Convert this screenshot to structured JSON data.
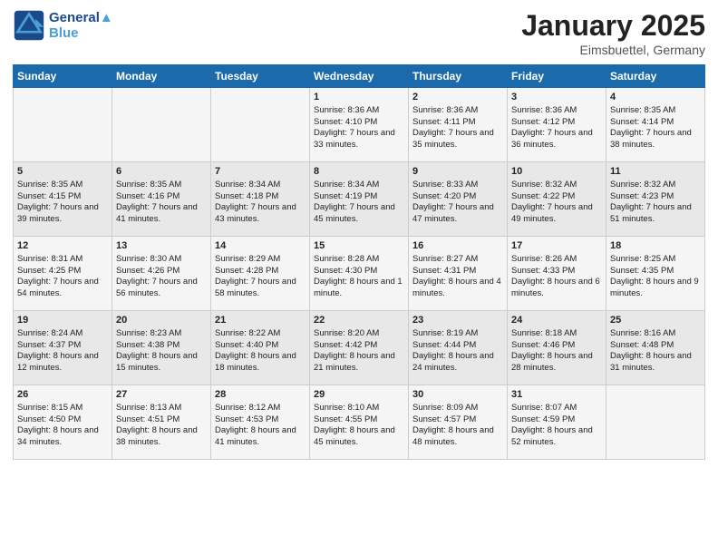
{
  "header": {
    "logo_line1": "General",
    "logo_line2": "Blue",
    "month": "January 2025",
    "location": "Eimsbuettel, Germany"
  },
  "days_of_week": [
    "Sunday",
    "Monday",
    "Tuesday",
    "Wednesday",
    "Thursday",
    "Friday",
    "Saturday"
  ],
  "weeks": [
    [
      {
        "day": "",
        "sunrise": "",
        "sunset": "",
        "daylight": ""
      },
      {
        "day": "",
        "sunrise": "",
        "sunset": "",
        "daylight": ""
      },
      {
        "day": "",
        "sunrise": "",
        "sunset": "",
        "daylight": ""
      },
      {
        "day": "1",
        "sunrise": "Sunrise: 8:36 AM",
        "sunset": "Sunset: 4:10 PM",
        "daylight": "Daylight: 7 hours and 33 minutes."
      },
      {
        "day": "2",
        "sunrise": "Sunrise: 8:36 AM",
        "sunset": "Sunset: 4:11 PM",
        "daylight": "Daylight: 7 hours and 35 minutes."
      },
      {
        "day": "3",
        "sunrise": "Sunrise: 8:36 AM",
        "sunset": "Sunset: 4:12 PM",
        "daylight": "Daylight: 7 hours and 36 minutes."
      },
      {
        "day": "4",
        "sunrise": "Sunrise: 8:35 AM",
        "sunset": "Sunset: 4:14 PM",
        "daylight": "Daylight: 7 hours and 38 minutes."
      }
    ],
    [
      {
        "day": "5",
        "sunrise": "Sunrise: 8:35 AM",
        "sunset": "Sunset: 4:15 PM",
        "daylight": "Daylight: 7 hours and 39 minutes."
      },
      {
        "day": "6",
        "sunrise": "Sunrise: 8:35 AM",
        "sunset": "Sunset: 4:16 PM",
        "daylight": "Daylight: 7 hours and 41 minutes."
      },
      {
        "day": "7",
        "sunrise": "Sunrise: 8:34 AM",
        "sunset": "Sunset: 4:18 PM",
        "daylight": "Daylight: 7 hours and 43 minutes."
      },
      {
        "day": "8",
        "sunrise": "Sunrise: 8:34 AM",
        "sunset": "Sunset: 4:19 PM",
        "daylight": "Daylight: 7 hours and 45 minutes."
      },
      {
        "day": "9",
        "sunrise": "Sunrise: 8:33 AM",
        "sunset": "Sunset: 4:20 PM",
        "daylight": "Daylight: 7 hours and 47 minutes."
      },
      {
        "day": "10",
        "sunrise": "Sunrise: 8:32 AM",
        "sunset": "Sunset: 4:22 PM",
        "daylight": "Daylight: 7 hours and 49 minutes."
      },
      {
        "day": "11",
        "sunrise": "Sunrise: 8:32 AM",
        "sunset": "Sunset: 4:23 PM",
        "daylight": "Daylight: 7 hours and 51 minutes."
      }
    ],
    [
      {
        "day": "12",
        "sunrise": "Sunrise: 8:31 AM",
        "sunset": "Sunset: 4:25 PM",
        "daylight": "Daylight: 7 hours and 54 minutes."
      },
      {
        "day": "13",
        "sunrise": "Sunrise: 8:30 AM",
        "sunset": "Sunset: 4:26 PM",
        "daylight": "Daylight: 7 hours and 56 minutes."
      },
      {
        "day": "14",
        "sunrise": "Sunrise: 8:29 AM",
        "sunset": "Sunset: 4:28 PM",
        "daylight": "Daylight: 7 hours and 58 minutes."
      },
      {
        "day": "15",
        "sunrise": "Sunrise: 8:28 AM",
        "sunset": "Sunset: 4:30 PM",
        "daylight": "Daylight: 8 hours and 1 minute."
      },
      {
        "day": "16",
        "sunrise": "Sunrise: 8:27 AM",
        "sunset": "Sunset: 4:31 PM",
        "daylight": "Daylight: 8 hours and 4 minutes."
      },
      {
        "day": "17",
        "sunrise": "Sunrise: 8:26 AM",
        "sunset": "Sunset: 4:33 PM",
        "daylight": "Daylight: 8 hours and 6 minutes."
      },
      {
        "day": "18",
        "sunrise": "Sunrise: 8:25 AM",
        "sunset": "Sunset: 4:35 PM",
        "daylight": "Daylight: 8 hours and 9 minutes."
      }
    ],
    [
      {
        "day": "19",
        "sunrise": "Sunrise: 8:24 AM",
        "sunset": "Sunset: 4:37 PM",
        "daylight": "Daylight: 8 hours and 12 minutes."
      },
      {
        "day": "20",
        "sunrise": "Sunrise: 8:23 AM",
        "sunset": "Sunset: 4:38 PM",
        "daylight": "Daylight: 8 hours and 15 minutes."
      },
      {
        "day": "21",
        "sunrise": "Sunrise: 8:22 AM",
        "sunset": "Sunset: 4:40 PM",
        "daylight": "Daylight: 8 hours and 18 minutes."
      },
      {
        "day": "22",
        "sunrise": "Sunrise: 8:20 AM",
        "sunset": "Sunset: 4:42 PM",
        "daylight": "Daylight: 8 hours and 21 minutes."
      },
      {
        "day": "23",
        "sunrise": "Sunrise: 8:19 AM",
        "sunset": "Sunset: 4:44 PM",
        "daylight": "Daylight: 8 hours and 24 minutes."
      },
      {
        "day": "24",
        "sunrise": "Sunrise: 8:18 AM",
        "sunset": "Sunset: 4:46 PM",
        "daylight": "Daylight: 8 hours and 28 minutes."
      },
      {
        "day": "25",
        "sunrise": "Sunrise: 8:16 AM",
        "sunset": "Sunset: 4:48 PM",
        "daylight": "Daylight: 8 hours and 31 minutes."
      }
    ],
    [
      {
        "day": "26",
        "sunrise": "Sunrise: 8:15 AM",
        "sunset": "Sunset: 4:50 PM",
        "daylight": "Daylight: 8 hours and 34 minutes."
      },
      {
        "day": "27",
        "sunrise": "Sunrise: 8:13 AM",
        "sunset": "Sunset: 4:51 PM",
        "daylight": "Daylight: 8 hours and 38 minutes."
      },
      {
        "day": "28",
        "sunrise": "Sunrise: 8:12 AM",
        "sunset": "Sunset: 4:53 PM",
        "daylight": "Daylight: 8 hours and 41 minutes."
      },
      {
        "day": "29",
        "sunrise": "Sunrise: 8:10 AM",
        "sunset": "Sunset: 4:55 PM",
        "daylight": "Daylight: 8 hours and 45 minutes."
      },
      {
        "day": "30",
        "sunrise": "Sunrise: 8:09 AM",
        "sunset": "Sunset: 4:57 PM",
        "daylight": "Daylight: 8 hours and 48 minutes."
      },
      {
        "day": "31",
        "sunrise": "Sunrise: 8:07 AM",
        "sunset": "Sunset: 4:59 PM",
        "daylight": "Daylight: 8 hours and 52 minutes."
      },
      {
        "day": "",
        "sunrise": "",
        "sunset": "",
        "daylight": ""
      }
    ]
  ]
}
